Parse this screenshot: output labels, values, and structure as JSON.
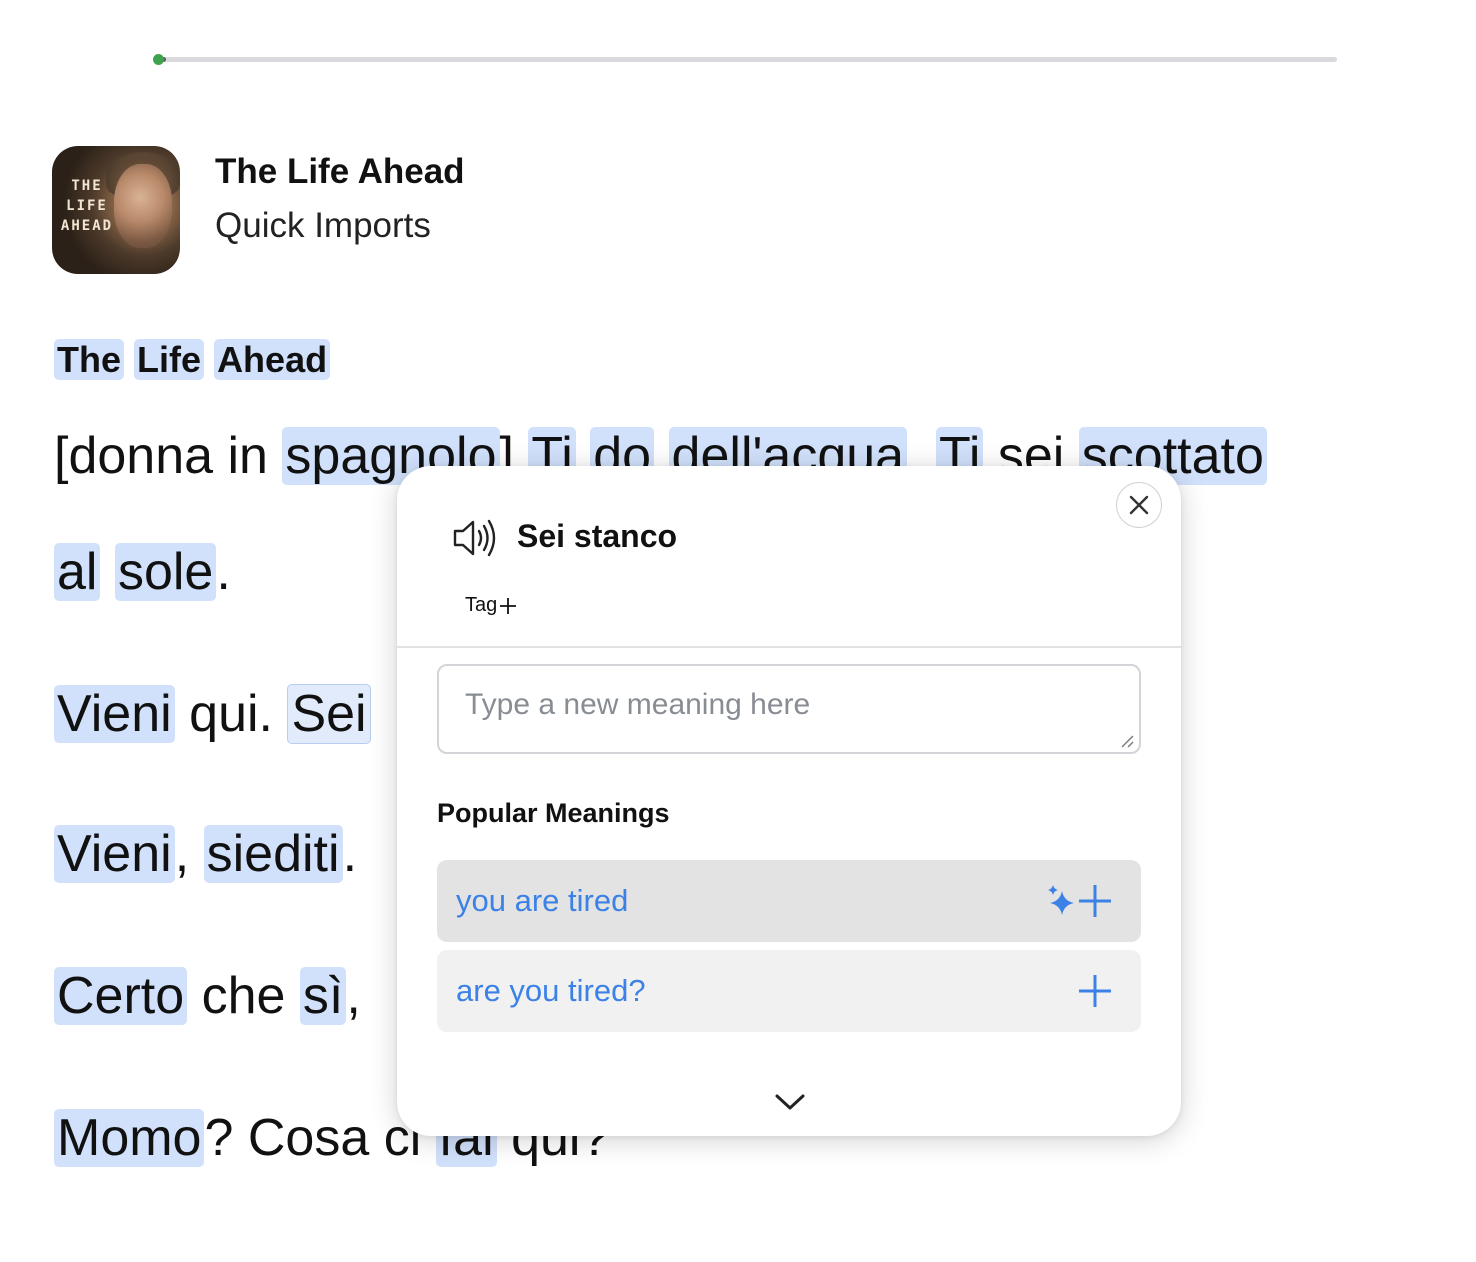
{
  "progress": {
    "fraction": 0.005
  },
  "header": {
    "cover_title_lines": [
      "THE",
      "LIFE",
      "AHEAD"
    ],
    "title": "The Life Ahead",
    "subtitle": "Quick Imports"
  },
  "reader": {
    "heading_words": [
      "The",
      "Life",
      "Ahead"
    ],
    "lines": [
      {
        "tokens": [
          {
            "t": "[donna in ",
            "h": false
          },
          {
            "t": "spagnolo",
            "h": true
          },
          {
            "t": "] ",
            "h": false
          },
          {
            "t": "Ti",
            "h": true
          },
          {
            "t": " ",
            "h": false
          },
          {
            "t": "do",
            "h": true
          },
          {
            "t": " ",
            "h": false
          },
          {
            "t": "dell'acqua",
            "h": true
          },
          {
            "t": ". ",
            "h": false
          },
          {
            "t": "Ti",
            "h": true
          },
          {
            "t": " sei ",
            "h": false
          },
          {
            "t": "scottato",
            "h": true
          }
        ]
      },
      {
        "tokens": [
          {
            "t": "al",
            "h": true
          },
          {
            "t": " ",
            "h": false
          },
          {
            "t": "sole",
            "h": true
          },
          {
            "t": ".",
            "h": false
          }
        ]
      },
      {
        "tokens": [
          {
            "t": "Vieni",
            "h": true
          },
          {
            "t": " qui. ",
            "h": false
          },
          {
            "t": "Sei",
            "h": true,
            "sel": true
          }
        ]
      },
      {
        "tokens": [
          {
            "t": "Vieni",
            "h": true
          },
          {
            "t": ", ",
            "h": false
          },
          {
            "t": "siediti",
            "h": true
          },
          {
            "t": ".",
            "h": false
          }
        ]
      },
      {
        "tokens": [
          {
            "t": "Certo",
            "h": true
          },
          {
            "t": " che ",
            "h": false
          },
          {
            "t": "sì",
            "h": true
          },
          {
            "t": ",",
            "h": false
          }
        ]
      },
      {
        "tokens": [
          {
            "t": "Momo",
            "h": true
          },
          {
            "t": "? Cosa ci ",
            "h": false
          },
          {
            "t": "fai",
            "h": true
          },
          {
            "t": " qui?",
            "h": false
          }
        ]
      }
    ]
  },
  "popup": {
    "phrase": "Sei stanco",
    "tag_label": "Tag",
    "meaning_placeholder": "Type a new meaning here",
    "popular_heading": "Popular Meanings",
    "meanings": [
      "you are tired",
      "are you tired?"
    ],
    "accent_color": "#3c82e6"
  },
  "icons": [
    "speaker-icon",
    "close-icon",
    "plus-icon",
    "sparkle-icon",
    "chevron-down-icon"
  ]
}
